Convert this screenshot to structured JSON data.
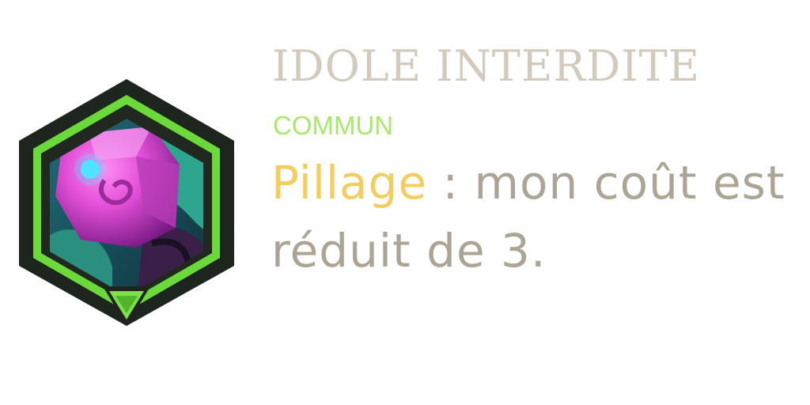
{
  "card": {
    "title": "IDOLE INTERDITE",
    "rarity": "COMMUN",
    "keyword": "Pillage",
    "description": " : mon coût est réduit de 3.",
    "icon": "crystal-idol-icon",
    "badge_icon": "triangle-down-icon"
  },
  "colors": {
    "title": "#d2cbbd",
    "rarity": "#a8e96b",
    "keyword": "#f3cd5f",
    "body_text": "#aca596",
    "hex_frame_dark": "#1e241e",
    "hex_frame_green": "#6bd93a",
    "crystal": "#e24fd7",
    "background_teal": "#1e8a7a"
  }
}
